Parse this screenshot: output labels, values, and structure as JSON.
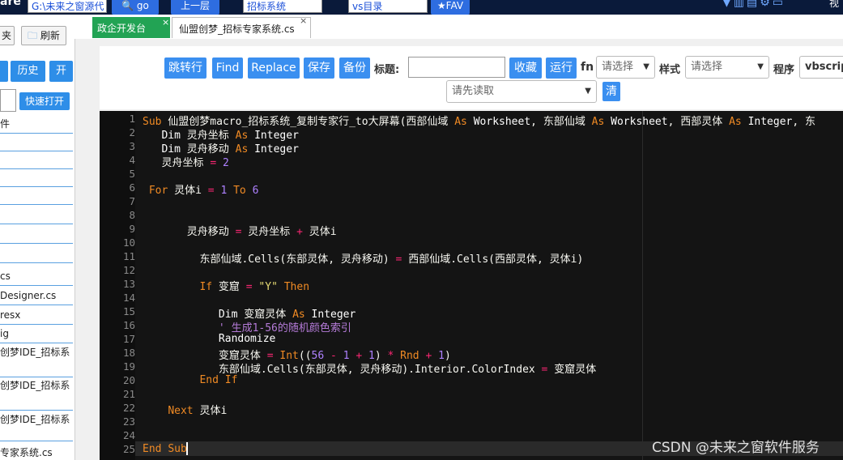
{
  "topbar": {
    "brand": "are",
    "path_value": "G:\\未来之窗源代",
    "go_label": "go",
    "up_label": "上一层",
    "search1_value": "招标系统",
    "search2_value": "vs目录",
    "fav_label": "★FAV",
    "right_label": "视"
  },
  "sidebar": {
    "folder_label": "夹",
    "refresh_label": "刷新",
    "history_label": "历史",
    "open_label": "开",
    "quick_open_label": "快速打开",
    "file_header": "件",
    "files": [
      "",
      "",
      "",
      "",
      "",
      "",
      "",
      "cs",
      "Designer.cs",
      "resx",
      "ig",
      "创梦IDE_招标系",
      "创梦IDE_招标系",
      "创梦IDE_招标系",
      "专家系统.cs"
    ]
  },
  "tabs": {
    "active": "政企开发台",
    "file": "仙盟创梦_招标专家系统.cs",
    "close": "×"
  },
  "toolbar": {
    "jump": "跳转行",
    "find": "Find",
    "replace": "Replace",
    "save": "保存",
    "backup": "备份",
    "title_label": "标题:",
    "title_value": "",
    "collect": "收藏",
    "run": "运行",
    "fn_label": "fn",
    "fn_select": "请选择",
    "style_label": "样式",
    "style_select": "请选择",
    "program_label": "程序",
    "program_select": "vbscript",
    "read_first": "请先读取",
    "clear": "清"
  },
  "editor": {
    "language": "vbscript",
    "line_numbers": [
      "1",
      "2",
      "3",
      "4",
      "5",
      "6",
      "7",
      "8",
      "9",
      "10",
      "11",
      "12",
      "13",
      "14",
      "15",
      "16",
      "17",
      "18",
      "19",
      "20",
      "21",
      "22",
      "23",
      "24",
      "25"
    ],
    "lines": [
      "Sub 仙盟创梦macro_招标系统_复制专家行_to大屏幕(西部仙域 As Worksheet, 东部仙域 As Worksheet, 西部灵体 As Integer, 东",
      "   Dim 灵舟坐标 As Integer",
      "   Dim 灵舟移动 As Integer",
      "   灵舟坐标 = 2",
      "",
      " For 灵体i = 1 To 6",
      "",
      "",
      "       灵舟移动 = 灵舟坐标 + 灵体i",
      "",
      "         东部仙域.Cells(东部灵体, 灵舟移动) = 西部仙域.Cells(西部灵体, 灵体i)",
      "",
      "         If 变窟 = \"Y\" Then",
      "",
      "            Dim 变窟灵体 As Integer",
      "            ' 生成1-56的随机颜色索引",
      "            Randomize",
      "            变窟灵体 = Int((56 - 1 + 1) * Rnd + 1)",
      "            东部仙域.Cells(东部灵体, 灵舟移动).Interior.ColorIndex = 变窟灵体",
      "         End If",
      "",
      "    Next 灵体i",
      "",
      "",
      "End Sub"
    ]
  },
  "watermark": "CSDN @未来之窗软件服务"
}
